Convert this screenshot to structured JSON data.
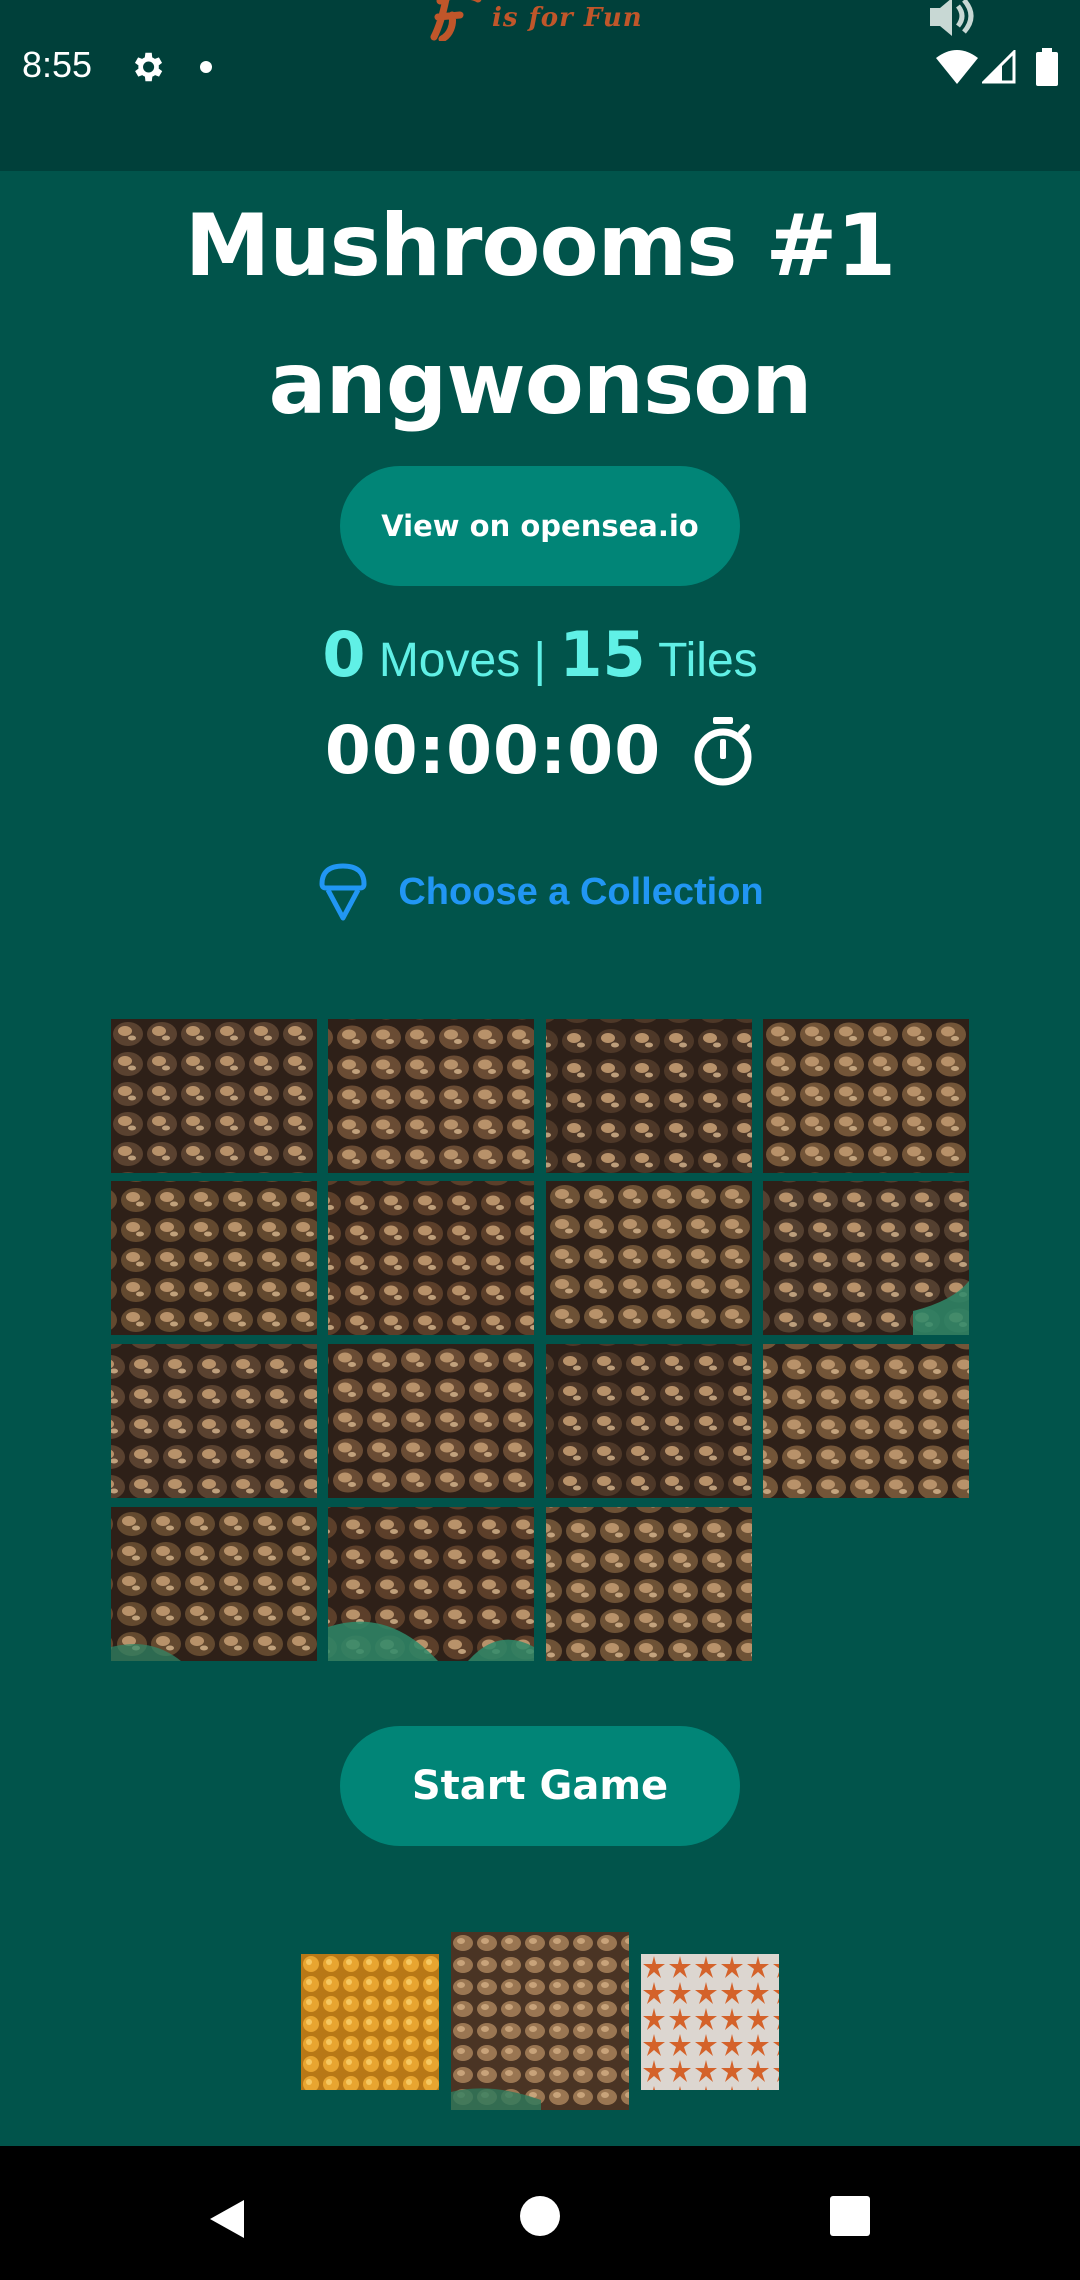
{
  "status_bar": {
    "time": "8:55",
    "icons": [
      "gear-icon",
      "notification-dot-icon",
      "speaker-icon",
      "wifi-icon",
      "signal-icon",
      "battery-icon"
    ]
  },
  "app_logo": {
    "text": "is for Fun",
    "letter": "F"
  },
  "puzzle": {
    "title": "Mushrooms #1",
    "author": "angwonson",
    "opensea_label": "View on opensea.io",
    "moves_count": "0",
    "moves_label": "Moves |",
    "tiles_count": "15",
    "tiles_label": "Tiles",
    "timer": "00:00:00",
    "timer_icon": "stopwatch-icon"
  },
  "collection": {
    "label": "Choose a Collection",
    "icon": "ice-cream-cone-icon"
  },
  "board": {
    "rows": 4,
    "cols": 4,
    "tile_count": 15,
    "empty_slot": "row 4, col 4"
  },
  "start_label": "Start Game",
  "thumbnails": [
    {
      "name": "yellow-mushrooms"
    },
    {
      "name": "shiitake-mushrooms",
      "selected": true
    },
    {
      "name": "orange-starfish"
    }
  ],
  "nav": {
    "icons": [
      "back-icon",
      "home-icon",
      "recents-icon"
    ]
  },
  "colors": {
    "background": "#01544b",
    "status_bar": "#00403a",
    "button": "#018577",
    "stat_text": "#60f0e6",
    "link": "#2196f3",
    "logo": "#c0562a"
  }
}
